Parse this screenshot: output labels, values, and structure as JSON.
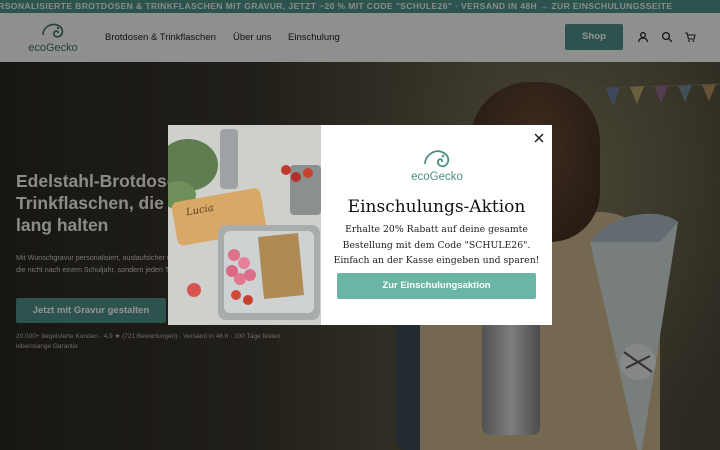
{
  "announcement": {
    "text": "PERSONALISIERTE BROTDOSEN & TRINKFLASCHEN MIT GRAVUR, JETZT −20 % MIT CODE \"SCHULE26\" · VERSAND IN 48H → ZUR EINSCHULUNGSSEITE"
  },
  "header": {
    "logo_text": "ecoGecko",
    "nav": [
      "Brotdosen & Trinkflaschen",
      "Über uns",
      "Einschulung"
    ],
    "shop_label": "Shop",
    "icons": [
      "account-icon",
      "search-icon",
      "cart-icon"
    ]
  },
  "hero": {
    "title": "Edelstahl-Brotdosen und Trinkflaschen, die ein Leben lang halten",
    "subtitle": "Mit Wunschgravur personalisiert, auslaufsicher und plastikfrei. Eine Dose, die nicht nach einem Schuljahr, sondern jeden Tag dabei ist.",
    "cta_label": "Jetzt mit Gravur gestalten",
    "social_proof": "20.000+ begeisterte Kunden · 4,9 ★ (721 Bewertungen) · Versand in 48 h · 100 Tage testen · lebenslange Garantie"
  },
  "modal": {
    "logo_text": "ecoGecko",
    "title": "Einschulungs-Aktion",
    "text_line1": "Erhalte 20% Rabatt auf deine gesamte",
    "text_line2": "Bestellung mit dem Code \"SCHULE26\".",
    "text_line3": "Einfach an der Kasse eingeben und sparen!",
    "button_label": "Zur Einschulungsaktion",
    "image_name_tag": "Lucia"
  },
  "colors": {
    "brand": "#4d8f85",
    "modal_button": "#6bb5a5"
  }
}
